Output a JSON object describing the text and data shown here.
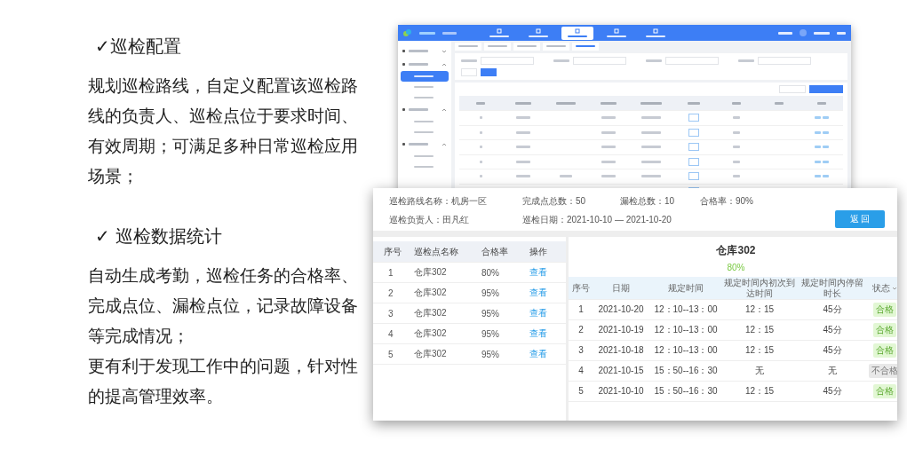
{
  "intro": [
    {
      "heading": "✓巡检配置",
      "paragraphs": [
        "规划巡检路线，自定义配置该巡检路线的负责人、巡检点位于要求时间、有效周期；可满足多种日常巡检应用场景；"
      ]
    },
    {
      "heading": "✓ 巡检数据统计",
      "paragraphs": [
        "自动生成考勤，巡检任务的合格率、完成点位、漏检点位，记录故障设备等完成情况；",
        "更有利于发现工作中的问题，针对性的提高管理效率。"
      ]
    }
  ],
  "back_window": {
    "nav": [
      {
        "selected": false
      },
      {
        "selected": false
      },
      {
        "selected": true
      },
      {
        "selected": false
      },
      {
        "selected": false
      }
    ],
    "sidebar": [
      {
        "expanded": false
      },
      {
        "expanded": true,
        "children": [
          {
            "selected": true
          },
          {
            "selected": false
          },
          {
            "selected": false
          }
        ]
      },
      {
        "expanded": true,
        "children": [
          {
            "selected": false
          },
          {
            "selected": false
          }
        ]
      },
      {
        "expanded": true,
        "children": [
          {
            "selected": false
          },
          {
            "selected": false
          }
        ]
      }
    ],
    "tabs": [
      {
        "selected": false
      },
      {
        "selected": false
      },
      {
        "selected": false
      },
      {
        "selected": false
      },
      {
        "selected": true
      }
    ]
  },
  "detail_panel": {
    "info": [
      {
        "label": "巡检路线名称：",
        "value": "机房一区"
      },
      {
        "label": "完成点总数：",
        "value": "50"
      },
      {
        "label": "漏检总数：",
        "value": "10"
      },
      {
        "label": "合格率：",
        "value": "90%"
      },
      {
        "label": "巡检负责人：",
        "value": "田凡红"
      },
      {
        "label": "巡检日期：",
        "value": "2021-10-10 — 2021-10-20"
      }
    ],
    "back_button": "返 回",
    "points_columns": [
      "序号",
      "巡检点名称",
      "合格率",
      "操作"
    ],
    "points": [
      {
        "no": "1",
        "name": "仓库302",
        "rate": "80%",
        "action": "查看"
      },
      {
        "no": "2",
        "name": "仓库302",
        "rate": "95%",
        "action": "查看"
      },
      {
        "no": "3",
        "name": "仓库302",
        "rate": "95%",
        "action": "查看"
      },
      {
        "no": "4",
        "name": "仓库302",
        "rate": "95%",
        "action": "查看"
      },
      {
        "no": "5",
        "name": "仓库302",
        "rate": "95%",
        "action": "查看"
      }
    ],
    "detail_title": "仓库302",
    "detail_rate": "80%",
    "detail_columns": [
      "序号",
      "日期",
      "规定时间",
      "规定时间内初次到达时间",
      "规定时间内停留时长",
      "状态"
    ],
    "records": [
      {
        "no": "1",
        "date": "2021-10-20",
        "window": "12：10--13：00",
        "arrival": "12：15",
        "stay": "45分",
        "status": "合格",
        "pass": true
      },
      {
        "no": "2",
        "date": "2021-10-19",
        "window": "12：10--13：00",
        "arrival": "12：15",
        "stay": "45分",
        "status": "合格",
        "pass": true
      },
      {
        "no": "3",
        "date": "2021-10-18",
        "window": "12：10--13：00",
        "arrival": "12：15",
        "stay": "45分",
        "status": "合格",
        "pass": true
      },
      {
        "no": "4",
        "date": "2021-10-15",
        "window": "15：50--16：30",
        "arrival": "无",
        "stay": "无",
        "status": "不合格",
        "pass": false
      },
      {
        "no": "5",
        "date": "2021-10-10",
        "window": "15：50--16：30",
        "arrival": "12：15",
        "stay": "45分",
        "status": "合格",
        "pass": true
      }
    ]
  }
}
